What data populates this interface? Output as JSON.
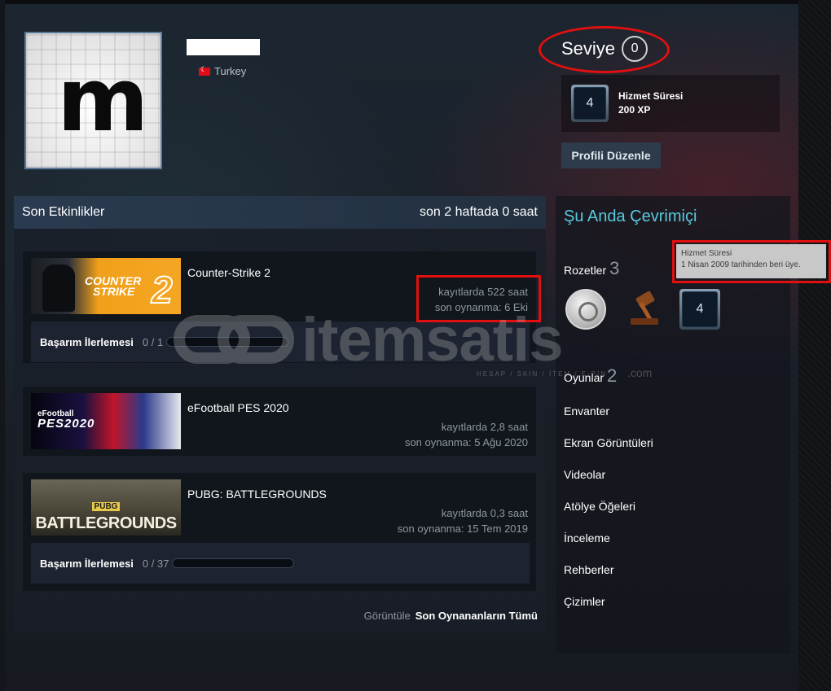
{
  "profile": {
    "country": "Turkey",
    "avatar_letter": "m"
  },
  "level": {
    "label": "Seviye",
    "value": "0"
  },
  "service_badge": {
    "badge_number": "4",
    "title": "Hizmet Süresi",
    "xp": "200 XP"
  },
  "edit_profile_label": "Profili Düzenle",
  "activity": {
    "title": "Son Etkinlikler",
    "summary": "son 2 haftada 0 saat",
    "games": [
      {
        "name": "Counter-Strike 2",
        "hours": "kayıtlarda 522 saat",
        "last_played": "son oynanma: 6 Eki",
        "achievement_label": "Başarım İlerlemesi",
        "achievement_count": "0 / 1",
        "achievement_progress": 0,
        "cover_text_line1": "COUNTER",
        "cover_text_line2": "STRIKE",
        "cover_text_number": "2"
      },
      {
        "name": "eFootball PES 2020",
        "hours": "kayıtlarda 2,8 saat",
        "last_played": "son oynanma: 5 Ağu 2020",
        "cover_text_line1": "eFootball",
        "cover_text_line2": "PES2020"
      },
      {
        "name": "PUBG: BATTLEGROUNDS",
        "hours": "kayıtlarda 0,3 saat",
        "last_played": "son oynanma: 15 Tem 2019",
        "achievement_label": "Başarım İlerlemesi",
        "achievement_count": "0 / 37",
        "achievement_progress": 0,
        "cover_text_line1": "PUBG",
        "cover_text_line2": "BATTLEGROUNDS"
      }
    ],
    "view_label": "Görüntüle",
    "view_all_label": "Son Oynananların Tümü"
  },
  "sidebar": {
    "online_status": "Şu Anda Çevrimiçi",
    "badges_label": "Rozetler",
    "badges_count": "3",
    "badge_number": "4",
    "games_label": "Oyunlar",
    "games_count": "2",
    "links": [
      "Envanter",
      "Ekran Görüntüleri",
      "Videolar",
      "Atölye Öğeleri",
      "İnceleme",
      "Rehberler",
      "Çizimler"
    ]
  },
  "tooltip": {
    "title": "Hizmet Süresi",
    "text": "1 Nisan 2009 tarihinden beri üye."
  },
  "watermark": {
    "text": "itemsatis",
    "subtext": "HESAP / SKIN / İTEM / E-PİN",
    "domain": ".com"
  },
  "colors": {
    "accent_online": "#57cbde",
    "annotation_red": "#e01010",
    "header_blue": "#2a3a50"
  }
}
